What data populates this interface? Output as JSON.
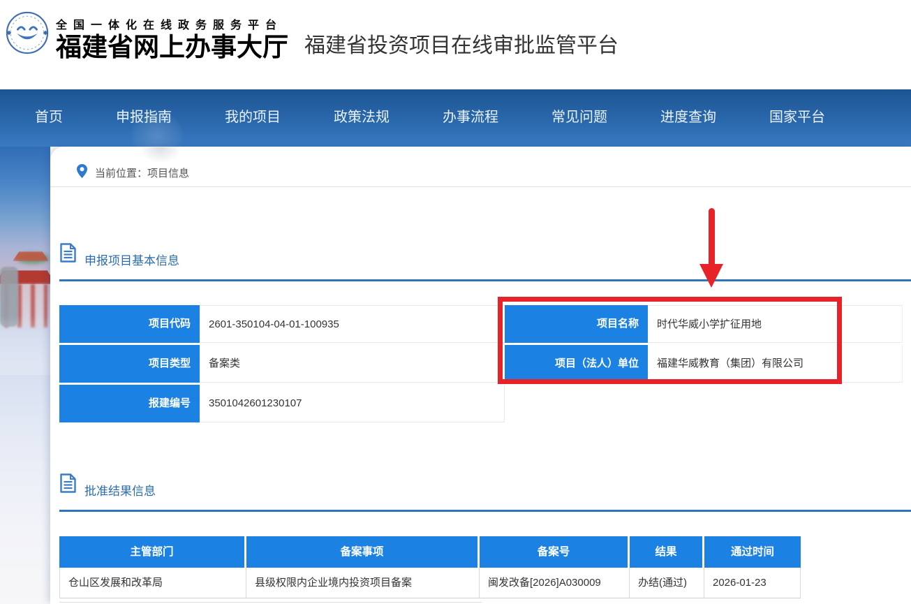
{
  "header": {
    "logo_line1": "全国一体化在线政务服务平台",
    "logo_line2": "福建省网上办事大厅",
    "platform_title": "福建省投资项目在线审批监管平台"
  },
  "nav": {
    "items": [
      "首页",
      "申报指南",
      "我的项目",
      "政策法规",
      "办事流程",
      "常见问题",
      "进度查询",
      "国家平台"
    ]
  },
  "breadcrumb": {
    "prefix": "当前位置：",
    "current": "项目信息"
  },
  "basic": {
    "title": "申报项目基本信息",
    "left": [
      {
        "label": "项目代码",
        "value": "2601-350104-04-01-100935"
      },
      {
        "label": "项目类型",
        "value": "备案类"
      },
      {
        "label": "报建编号",
        "value": "3501042601230107"
      }
    ],
    "right": [
      {
        "label": "项目名称",
        "value": "时代华威小学扩征用地"
      },
      {
        "label": "项目（法人）单位",
        "value": "福建华威教育（集团）有限公司"
      }
    ]
  },
  "approval": {
    "title": "批准结果信息",
    "columns": [
      "主管部门",
      "备案事项",
      "备案号",
      "结果",
      "通过时间"
    ],
    "rows": [
      [
        "仓山区发展和改革局",
        "县级权限内企业境内投资项目备案",
        "闽发改备[2026]A030009",
        "办结(通过)",
        "2026-01-23"
      ]
    ]
  },
  "colors": {
    "nav_blue": "#2a68ac",
    "cell_blue": "#1b82e4",
    "section_blue": "#2b6cad",
    "underline_blue": "#2e74b8",
    "annotation_red": "#e62329"
  }
}
